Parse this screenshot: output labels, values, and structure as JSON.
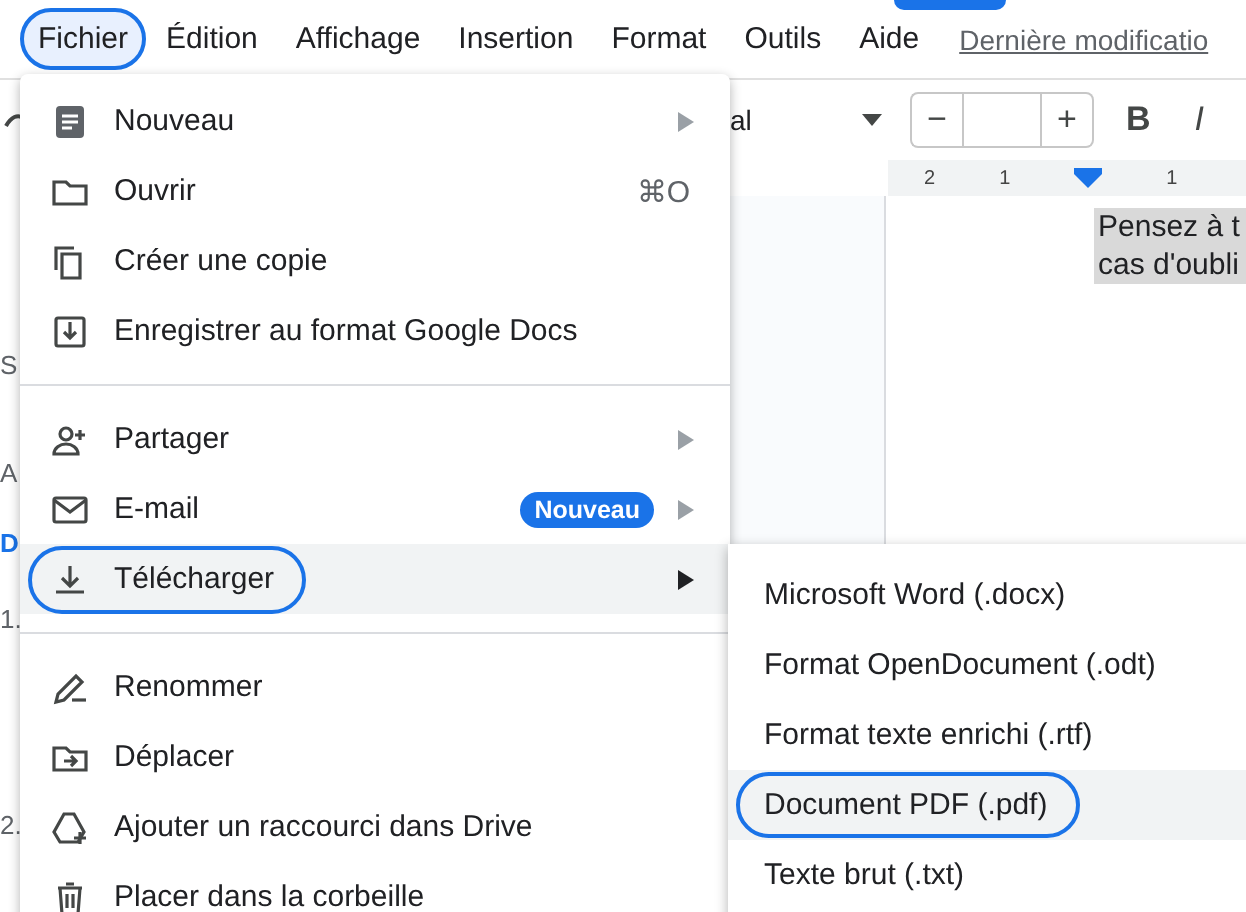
{
  "menu_bar": {
    "items": [
      {
        "label": "Fichier",
        "selected": true
      },
      {
        "label": "Édition",
        "selected": false
      },
      {
        "label": "Affichage",
        "selected": false
      },
      {
        "label": "Insertion",
        "selected": false
      },
      {
        "label": "Format",
        "selected": false
      },
      {
        "label": "Outils",
        "selected": false
      },
      {
        "label": "Aide",
        "selected": false
      }
    ],
    "last_modified": "Dernière modificatio"
  },
  "toolbar": {
    "font": "al",
    "size_minus": "−",
    "size_plus": "+",
    "bold": "B",
    "italic": "I"
  },
  "ruler": {
    "numbers": [
      "2",
      "1",
      "1"
    ]
  },
  "outline": [
    {
      "text": "S",
      "color": "#5f6368"
    },
    {
      "text": "A",
      "color": "#5f6368"
    },
    {
      "text": "D",
      "color": "#1a73e8"
    },
    {
      "text": "1.",
      "color": "#5f6368"
    },
    {
      "text": "2.",
      "color": "#5f6368"
    }
  ],
  "document": {
    "lines": [
      "Pensez à t",
      "cas d'oubli"
    ]
  },
  "file_menu": {
    "items": [
      {
        "kind": "item",
        "label": "Nouveau",
        "submenu": true,
        "selected": false
      },
      {
        "kind": "item",
        "label": "Ouvrir",
        "shortcut": "⌘O",
        "submenu": false,
        "selected": false
      },
      {
        "kind": "item",
        "label": "Créer une copie",
        "submenu": false,
        "selected": false
      },
      {
        "kind": "item",
        "label": "Enregistrer au format Google Docs",
        "submenu": false,
        "selected": false
      },
      {
        "kind": "divider"
      },
      {
        "kind": "item",
        "label": "Partager",
        "submenu": true,
        "selected": false
      },
      {
        "kind": "item",
        "label": "E-mail",
        "badge": "Nouveau",
        "submenu": true,
        "selected": false
      },
      {
        "kind": "item",
        "label": "Télécharger",
        "submenu": true,
        "selected": true
      },
      {
        "kind": "divider"
      },
      {
        "kind": "item",
        "label": "Renommer",
        "submenu": false,
        "selected": false
      },
      {
        "kind": "item",
        "label": "Déplacer",
        "submenu": false,
        "selected": false
      },
      {
        "kind": "item",
        "label": "Ajouter un raccourci dans Drive",
        "submenu": false,
        "selected": false
      },
      {
        "kind": "item",
        "label": "Placer dans la corbeille",
        "submenu": false,
        "selected": false
      }
    ]
  },
  "download_menu": {
    "items": [
      {
        "label": "Microsoft Word (.docx)",
        "selected": false
      },
      {
        "label": "Format OpenDocument (.odt)",
        "selected": false
      },
      {
        "label": "Format texte enrichi (.rtf)",
        "selected": false
      },
      {
        "label": "Document PDF (.pdf)",
        "selected": true
      },
      {
        "label": "Texte brut (.txt)",
        "selected": false
      }
    ]
  }
}
